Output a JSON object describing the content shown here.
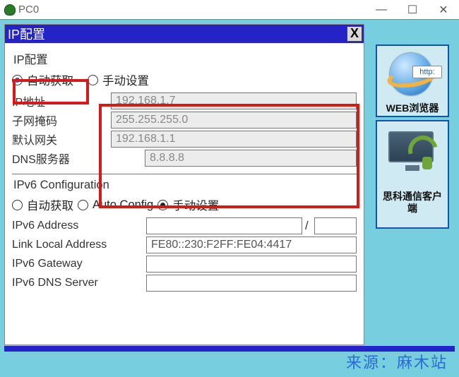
{
  "outer": {
    "title": "PC0"
  },
  "inner": {
    "title": "IP配置"
  },
  "ipv4": {
    "group": "IP配置",
    "auto": "自动获取",
    "manual": "手动设置",
    "addr_label": "IP地址",
    "addr": "192.168.1.7",
    "mask_label": "子网掩码",
    "mask": "255.255.255.0",
    "gw_label": "默认网关",
    "gw": "192.168.1.1",
    "dns_label": "DNS服务器",
    "dns": "8.8.8.8"
  },
  "ipv6": {
    "group": "IPv6 Configuration",
    "auto": "自动获取",
    "autoconfig": "Auto Config",
    "manual": "手动设置",
    "addr_label": "IPv6 Address",
    "link_label": "Link Local Address",
    "link_value": "FE80::230:F2FF:FE04:4417",
    "gw_label": "IPv6 Gateway",
    "dns_label": "IPv6 DNS Server"
  },
  "side": {
    "web": {
      "label": "WEB浏览器",
      "http": "http:"
    },
    "cisco": {
      "label": "思科通信客户端"
    }
  },
  "watermark": "来源：麻木站"
}
